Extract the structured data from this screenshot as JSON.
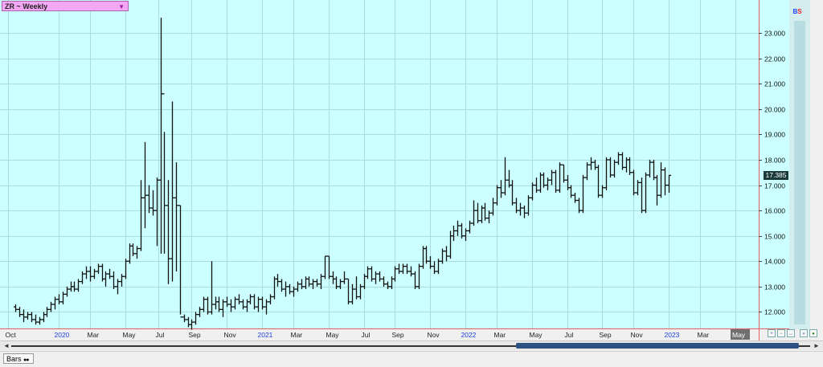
{
  "header": {
    "title": "ZR ~ Weekly",
    "badge_b": "B",
    "badge_s": "S",
    "last_price_label": "17.385"
  },
  "footer": {
    "tab_label": "Bars",
    "scroll_left": "◄",
    "scroll_right": "►"
  },
  "colors": {
    "plot_bg": "#ccffff",
    "grid": "#a8dede",
    "bars": "#111111",
    "border_red": "#e06060",
    "year_label": "#2040e0"
  },
  "chart_data": {
    "type": "bar",
    "subtype": "ohlc",
    "x_axis_labels": [
      {
        "t": -2,
        "label": "Oct",
        "year": false
      },
      {
        "t": 11,
        "label": "2020",
        "year": true
      },
      {
        "t": 19,
        "label": "Mar",
        "year": false
      },
      {
        "t": 28,
        "label": "May",
        "year": false
      },
      {
        "t": 36.5,
        "label": "Jul",
        "year": false
      },
      {
        "t": 45,
        "label": "Sep",
        "year": false
      },
      {
        "t": 54,
        "label": "Nov",
        "year": false
      },
      {
        "t": 63,
        "label": "2021",
        "year": true
      },
      {
        "t": 71,
        "label": "Mar",
        "year": false
      },
      {
        "t": 80,
        "label": "May",
        "year": false
      },
      {
        "t": 89,
        "label": "Jul",
        "year": false
      },
      {
        "t": 97,
        "label": "Sep",
        "year": false
      },
      {
        "t": 106,
        "label": "Nov",
        "year": false
      },
      {
        "t": 115,
        "label": "2022",
        "year": true
      },
      {
        "t": 123,
        "label": "Mar",
        "year": false
      },
      {
        "t": 132,
        "label": "May",
        "year": false
      },
      {
        "t": 141,
        "label": "Jul",
        "year": false
      },
      {
        "t": 150,
        "label": "Sep",
        "year": false
      },
      {
        "t": 158,
        "label": "Nov",
        "year": false
      },
      {
        "t": 167,
        "label": "2023",
        "year": true
      },
      {
        "t": 175,
        "label": "Mar",
        "year": false
      },
      {
        "t": 184,
        "label": "May",
        "year": false
      }
    ],
    "y_ticks": [
      "12.000",
      "13.000",
      "14.000",
      "15.000",
      "16.000",
      "17.000",
      "18.000",
      "19.000",
      "20.000",
      "21.000",
      "22.000",
      "23.000"
    ],
    "ylim": [
      11.35,
      24.3
    ],
    "xlim": [
      -4,
      190
    ],
    "last_price": 17.385,
    "bars": [
      {
        "o": 12.2,
        "h": 12.3,
        "l": 12.0,
        "c": 12.1
      },
      {
        "o": 12.1,
        "h": 12.2,
        "l": 11.8,
        "c": 11.9
      },
      {
        "o": 11.9,
        "h": 12.1,
        "l": 11.6,
        "c": 11.8
      },
      {
        "o": 11.8,
        "h": 12.0,
        "l": 11.7,
        "c": 11.9
      },
      {
        "o": 11.9,
        "h": 12.0,
        "l": 11.6,
        "c": 11.7
      },
      {
        "o": 11.7,
        "h": 11.9,
        "l": 11.5,
        "c": 11.6
      },
      {
        "o": 11.6,
        "h": 11.8,
        "l": 11.5,
        "c": 11.7
      },
      {
        "o": 11.7,
        "h": 12.0,
        "l": 11.6,
        "c": 11.9
      },
      {
        "o": 11.9,
        "h": 12.2,
        "l": 11.8,
        "c": 12.1
      },
      {
        "o": 12.1,
        "h": 12.4,
        "l": 12.0,
        "c": 12.3
      },
      {
        "o": 12.3,
        "h": 12.6,
        "l": 12.1,
        "c": 12.5
      },
      {
        "o": 12.5,
        "h": 12.7,
        "l": 12.3,
        "c": 12.4
      },
      {
        "o": 12.4,
        "h": 12.8,
        "l": 12.3,
        "c": 12.7
      },
      {
        "o": 12.7,
        "h": 13.0,
        "l": 12.6,
        "c": 12.9
      },
      {
        "o": 12.9,
        "h": 13.2,
        "l": 12.8,
        "c": 13.0
      },
      {
        "o": 13.0,
        "h": 13.2,
        "l": 12.8,
        "c": 12.9
      },
      {
        "o": 12.9,
        "h": 13.3,
        "l": 12.8,
        "c": 13.2
      },
      {
        "o": 13.2,
        "h": 13.6,
        "l": 13.1,
        "c": 13.5
      },
      {
        "o": 13.5,
        "h": 13.8,
        "l": 13.3,
        "c": 13.6
      },
      {
        "o": 13.6,
        "h": 13.8,
        "l": 13.2,
        "c": 13.4
      },
      {
        "o": 13.4,
        "h": 13.7,
        "l": 13.3,
        "c": 13.6
      },
      {
        "o": 13.6,
        "h": 13.9,
        "l": 13.5,
        "c": 13.8
      },
      {
        "o": 13.8,
        "h": 13.9,
        "l": 13.2,
        "c": 13.3
      },
      {
        "o": 13.3,
        "h": 13.6,
        "l": 13.0,
        "c": 13.5
      },
      {
        "o": 13.5,
        "h": 13.7,
        "l": 13.3,
        "c": 13.4
      },
      {
        "o": 13.4,
        "h": 13.6,
        "l": 12.9,
        "c": 13.0
      },
      {
        "o": 13.0,
        "h": 13.3,
        "l": 12.7,
        "c": 13.2
      },
      {
        "o": 13.2,
        "h": 13.5,
        "l": 13.0,
        "c": 13.4
      },
      {
        "o": 13.4,
        "h": 14.1,
        "l": 13.3,
        "c": 14.0
      },
      {
        "o": 14.0,
        "h": 14.7,
        "l": 13.9,
        "c": 14.6
      },
      {
        "o": 14.6,
        "h": 14.7,
        "l": 14.2,
        "c": 14.3
      },
      {
        "o": 14.3,
        "h": 14.6,
        "l": 14.1,
        "c": 14.5
      },
      {
        "o": 14.5,
        "h": 17.2,
        "l": 14.4,
        "c": 16.5
      },
      {
        "o": 16.5,
        "h": 18.7,
        "l": 15.3,
        "c": 16.6
      },
      {
        "o": 16.6,
        "h": 17.0,
        "l": 15.9,
        "c": 16.1
      },
      {
        "o": 16.1,
        "h": 16.8,
        "l": 15.8,
        "c": 16.0
      },
      {
        "o": 16.0,
        "h": 17.3,
        "l": 14.6,
        "c": 17.2
      },
      {
        "o": 17.2,
        "h": 23.6,
        "l": 14.3,
        "c": 20.6
      },
      {
        "o": 20.6,
        "h": 19.1,
        "l": 14.3,
        "c": 16.2
      },
      {
        "o": 16.2,
        "h": 17.2,
        "l": 13.1,
        "c": 14.1
      },
      {
        "o": 14.1,
        "h": 20.3,
        "l": 13.2,
        "c": 16.5
      },
      {
        "o": 16.5,
        "h": 17.9,
        "l": 13.6,
        "c": 16.2
      },
      {
        "o": 16.2,
        "h": 16.2,
        "l": 11.9,
        "c": 11.8
      },
      {
        "o": 11.8,
        "h": 11.9,
        "l": 11.6,
        "c": 11.7
      },
      {
        "o": 11.7,
        "h": 11.8,
        "l": 11.4,
        "c": 11.5
      },
      {
        "o": 11.5,
        "h": 11.7,
        "l": 11.3,
        "c": 11.6
      },
      {
        "o": 11.6,
        "h": 12.0,
        "l": 11.5,
        "c": 11.9
      },
      {
        "o": 11.9,
        "h": 12.2,
        "l": 11.8,
        "c": 12.1
      },
      {
        "o": 12.1,
        "h": 12.6,
        "l": 12.0,
        "c": 12.5
      },
      {
        "o": 12.5,
        "h": 12.6,
        "l": 11.9,
        "c": 12.0
      },
      {
        "o": 12.0,
        "h": 14.0,
        "l": 11.9,
        "c": 12.3
      },
      {
        "o": 12.3,
        "h": 12.6,
        "l": 12.1,
        "c": 12.4
      },
      {
        "o": 12.4,
        "h": 12.6,
        "l": 12.0,
        "c": 12.1
      },
      {
        "o": 12.1,
        "h": 12.5,
        "l": 11.8,
        "c": 12.4
      },
      {
        "o": 12.4,
        "h": 12.6,
        "l": 12.2,
        "c": 12.3
      },
      {
        "o": 12.3,
        "h": 12.5,
        "l": 12.0,
        "c": 12.2
      },
      {
        "o": 12.2,
        "h": 12.6,
        "l": 12.1,
        "c": 12.5
      },
      {
        "o": 12.5,
        "h": 12.7,
        "l": 12.3,
        "c": 12.4
      },
      {
        "o": 12.4,
        "h": 12.5,
        "l": 12.1,
        "c": 12.2
      },
      {
        "o": 12.2,
        "h": 12.5,
        "l": 12.0,
        "c": 12.4
      },
      {
        "o": 12.4,
        "h": 12.7,
        "l": 12.3,
        "c": 12.6
      },
      {
        "o": 12.6,
        "h": 12.7,
        "l": 12.1,
        "c": 12.2
      },
      {
        "o": 12.2,
        "h": 12.6,
        "l": 12.0,
        "c": 12.5
      },
      {
        "o": 12.5,
        "h": 12.6,
        "l": 12.1,
        "c": 12.2
      },
      {
        "o": 12.2,
        "h": 12.5,
        "l": 11.9,
        "c": 12.4
      },
      {
        "o": 12.4,
        "h": 12.7,
        "l": 12.3,
        "c": 12.6
      },
      {
        "o": 12.6,
        "h": 13.4,
        "l": 12.5,
        "c": 13.3
      },
      {
        "o": 13.3,
        "h": 13.5,
        "l": 13.0,
        "c": 13.2
      },
      {
        "o": 13.2,
        "h": 13.3,
        "l": 12.8,
        "c": 12.9
      },
      {
        "o": 12.9,
        "h": 13.2,
        "l": 12.6,
        "c": 13.0
      },
      {
        "o": 13.0,
        "h": 13.1,
        "l": 12.7,
        "c": 12.8
      },
      {
        "o": 12.8,
        "h": 13.0,
        "l": 12.6,
        "c": 12.9
      },
      {
        "o": 12.9,
        "h": 13.2,
        "l": 12.8,
        "c": 13.1
      },
      {
        "o": 13.1,
        "h": 13.3,
        "l": 12.9,
        "c": 13.0
      },
      {
        "o": 13.0,
        "h": 13.4,
        "l": 12.9,
        "c": 13.3
      },
      {
        "o": 13.3,
        "h": 13.4,
        "l": 13.0,
        "c": 13.1
      },
      {
        "o": 13.1,
        "h": 13.3,
        "l": 12.9,
        "c": 13.2
      },
      {
        "o": 13.2,
        "h": 13.3,
        "l": 13.0,
        "c": 13.1
      },
      {
        "o": 13.1,
        "h": 13.5,
        "l": 12.9,
        "c": 13.4
      },
      {
        "o": 13.4,
        "h": 14.2,
        "l": 13.3,
        "c": 14.2
      },
      {
        "o": 14.2,
        "h": 14.2,
        "l": 13.3,
        "c": 13.4
      },
      {
        "o": 13.4,
        "h": 13.6,
        "l": 13.1,
        "c": 13.3
      },
      {
        "o": 13.3,
        "h": 13.4,
        "l": 12.9,
        "c": 13.0
      },
      {
        "o": 13.0,
        "h": 13.3,
        "l": 12.9,
        "c": 13.2
      },
      {
        "o": 13.2,
        "h": 13.6,
        "l": 13.1,
        "c": 13.3
      },
      {
        "o": 13.3,
        "h": 13.3,
        "l": 12.3,
        "c": 12.4
      },
      {
        "o": 12.4,
        "h": 13.1,
        "l": 12.3,
        "c": 12.9
      },
      {
        "o": 12.9,
        "h": 13.4,
        "l": 12.5,
        "c": 12.6
      },
      {
        "o": 12.6,
        "h": 13.1,
        "l": 12.5,
        "c": 13.0
      },
      {
        "o": 13.0,
        "h": 13.5,
        "l": 12.9,
        "c": 13.4
      },
      {
        "o": 13.4,
        "h": 13.8,
        "l": 13.3,
        "c": 13.7
      },
      {
        "o": 13.7,
        "h": 13.8,
        "l": 13.2,
        "c": 13.3
      },
      {
        "o": 13.3,
        "h": 13.6,
        "l": 13.1,
        "c": 13.5
      },
      {
        "o": 13.5,
        "h": 13.6,
        "l": 13.2,
        "c": 13.3
      },
      {
        "o": 13.3,
        "h": 13.4,
        "l": 13.0,
        "c": 13.1
      },
      {
        "o": 13.1,
        "h": 13.2,
        "l": 12.9,
        "c": 13.0
      },
      {
        "o": 13.0,
        "h": 13.4,
        "l": 12.9,
        "c": 13.3
      },
      {
        "o": 13.3,
        "h": 13.8,
        "l": 13.2,
        "c": 13.7
      },
      {
        "o": 13.7,
        "h": 13.9,
        "l": 13.5,
        "c": 13.6
      },
      {
        "o": 13.6,
        "h": 13.9,
        "l": 13.5,
        "c": 13.8
      },
      {
        "o": 13.8,
        "h": 13.9,
        "l": 13.5,
        "c": 13.6
      },
      {
        "o": 13.6,
        "h": 13.8,
        "l": 13.4,
        "c": 13.5
      },
      {
        "o": 13.5,
        "h": 13.6,
        "l": 12.9,
        "c": 13.0
      },
      {
        "o": 13.0,
        "h": 13.9,
        "l": 12.9,
        "c": 13.8
      },
      {
        "o": 13.8,
        "h": 14.6,
        "l": 13.7,
        "c": 14.5
      },
      {
        "o": 14.5,
        "h": 14.6,
        "l": 13.9,
        "c": 14.0
      },
      {
        "o": 14.0,
        "h": 14.2,
        "l": 13.7,
        "c": 13.8
      },
      {
        "o": 13.8,
        "h": 14.0,
        "l": 13.5,
        "c": 13.6
      },
      {
        "o": 13.6,
        "h": 14.1,
        "l": 13.5,
        "c": 14.0
      },
      {
        "o": 14.0,
        "h": 14.5,
        "l": 13.9,
        "c": 14.4
      },
      {
        "o": 14.4,
        "h": 14.6,
        "l": 14.0,
        "c": 14.2
      },
      {
        "o": 14.2,
        "h": 15.2,
        "l": 14.1,
        "c": 15.0
      },
      {
        "o": 15.0,
        "h": 15.4,
        "l": 14.8,
        "c": 15.2
      },
      {
        "o": 15.2,
        "h": 15.6,
        "l": 15.0,
        "c": 15.4
      },
      {
        "o": 15.4,
        "h": 15.5,
        "l": 14.9,
        "c": 15.0
      },
      {
        "o": 15.0,
        "h": 15.3,
        "l": 14.8,
        "c": 15.2
      },
      {
        "o": 15.2,
        "h": 15.6,
        "l": 15.1,
        "c": 15.5
      },
      {
        "o": 15.5,
        "h": 16.4,
        "l": 15.4,
        "c": 16.0
      },
      {
        "o": 16.0,
        "h": 16.3,
        "l": 15.5,
        "c": 15.6
      },
      {
        "o": 15.6,
        "h": 16.2,
        "l": 15.5,
        "c": 16.1
      },
      {
        "o": 16.1,
        "h": 16.3,
        "l": 15.6,
        "c": 15.7
      },
      {
        "o": 15.7,
        "h": 16.0,
        "l": 15.5,
        "c": 15.9
      },
      {
        "o": 15.9,
        "h": 16.5,
        "l": 15.8,
        "c": 16.3
      },
      {
        "o": 16.3,
        "h": 17.0,
        "l": 16.2,
        "c": 16.9
      },
      {
        "o": 16.9,
        "h": 17.2,
        "l": 16.5,
        "c": 16.7
      },
      {
        "o": 16.7,
        "h": 18.1,
        "l": 16.6,
        "c": 17.2
      },
      {
        "o": 17.2,
        "h": 17.6,
        "l": 16.9,
        "c": 17.0
      },
      {
        "o": 17.0,
        "h": 17.2,
        "l": 16.2,
        "c": 16.3
      },
      {
        "o": 16.3,
        "h": 16.5,
        "l": 15.9,
        "c": 16.0
      },
      {
        "o": 16.0,
        "h": 16.3,
        "l": 15.8,
        "c": 16.1
      },
      {
        "o": 16.1,
        "h": 16.2,
        "l": 15.7,
        "c": 15.9
      },
      {
        "o": 15.9,
        "h": 16.6,
        "l": 15.8,
        "c": 16.5
      },
      {
        "o": 16.5,
        "h": 17.1,
        "l": 16.4,
        "c": 17.0
      },
      {
        "o": 17.0,
        "h": 17.3,
        "l": 16.7,
        "c": 16.8
      },
      {
        "o": 16.8,
        "h": 17.5,
        "l": 16.7,
        "c": 17.4
      },
      {
        "o": 17.4,
        "h": 17.5,
        "l": 16.9,
        "c": 17.0
      },
      {
        "o": 17.0,
        "h": 17.3,
        "l": 16.8,
        "c": 17.2
      },
      {
        "o": 17.2,
        "h": 17.6,
        "l": 17.0,
        "c": 17.5
      },
      {
        "o": 17.5,
        "h": 17.6,
        "l": 16.7,
        "c": 16.8
      },
      {
        "o": 16.8,
        "h": 17.9,
        "l": 16.7,
        "c": 17.8
      },
      {
        "o": 17.8,
        "h": 17.8,
        "l": 17.1,
        "c": 17.2
      },
      {
        "o": 17.2,
        "h": 17.4,
        "l": 16.8,
        "c": 16.9
      },
      {
        "o": 16.9,
        "h": 17.0,
        "l": 16.5,
        "c": 16.6
      },
      {
        "o": 16.6,
        "h": 16.7,
        "l": 16.3,
        "c": 16.4
      },
      {
        "o": 16.4,
        "h": 16.5,
        "l": 15.9,
        "c": 16.0
      },
      {
        "o": 16.0,
        "h": 17.4,
        "l": 15.9,
        "c": 17.3
      },
      {
        "o": 17.3,
        "h": 17.9,
        "l": 17.2,
        "c": 17.8
      },
      {
        "o": 17.8,
        "h": 18.1,
        "l": 17.6,
        "c": 17.9
      },
      {
        "o": 17.9,
        "h": 18.0,
        "l": 17.6,
        "c": 17.7
      },
      {
        "o": 17.7,
        "h": 17.8,
        "l": 16.5,
        "c": 16.6
      },
      {
        "o": 16.6,
        "h": 17.0,
        "l": 16.5,
        "c": 16.9
      },
      {
        "o": 16.9,
        "h": 18.1,
        "l": 16.8,
        "c": 18.0
      },
      {
        "o": 18.0,
        "h": 18.1,
        "l": 17.3,
        "c": 17.4
      },
      {
        "o": 17.4,
        "h": 18.0,
        "l": 17.3,
        "c": 17.9
      },
      {
        "o": 17.9,
        "h": 18.3,
        "l": 17.8,
        "c": 18.2
      },
      {
        "o": 18.2,
        "h": 18.3,
        "l": 17.6,
        "c": 17.7
      },
      {
        "o": 17.7,
        "h": 18.1,
        "l": 17.5,
        "c": 18.0
      },
      {
        "o": 18.0,
        "h": 18.1,
        "l": 17.4,
        "c": 17.5
      },
      {
        "o": 17.5,
        "h": 17.6,
        "l": 16.6,
        "c": 16.7
      },
      {
        "o": 16.7,
        "h": 17.2,
        "l": 16.6,
        "c": 17.1
      },
      {
        "o": 17.1,
        "h": 17.3,
        "l": 15.9,
        "c": 16.0
      },
      {
        "o": 16.0,
        "h": 17.5,
        "l": 15.9,
        "c": 17.4
      },
      {
        "o": 17.4,
        "h": 18.0,
        "l": 17.3,
        "c": 17.9
      },
      {
        "o": 17.9,
        "h": 18.0,
        "l": 17.2,
        "c": 17.3
      },
      {
        "o": 17.3,
        "h": 17.4,
        "l": 16.2,
        "c": 16.6
      },
      {
        "o": 16.6,
        "h": 17.9,
        "l": 16.5,
        "c": 17.6
      },
      {
        "o": 17.6,
        "h": 17.7,
        "l": 16.6,
        "c": 17.0
      },
      {
        "o": 17.0,
        "h": 17.4,
        "l": 16.7,
        "c": 17.385
      }
    ]
  }
}
